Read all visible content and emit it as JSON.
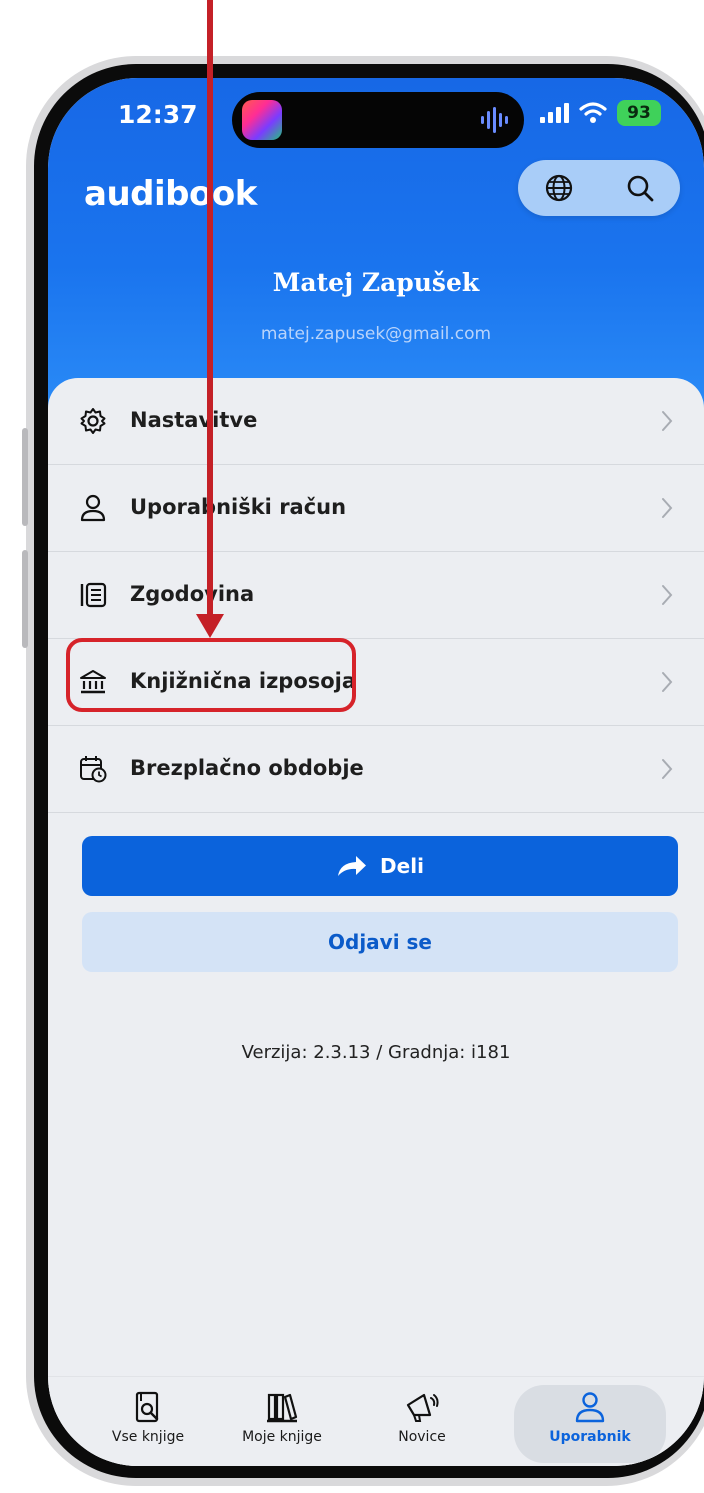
{
  "status_bar": {
    "time": "12:37",
    "battery": "93"
  },
  "header": {
    "logo": "audibook"
  },
  "profile": {
    "name": "Matej Zapušek",
    "email": "matej.zapusek@gmail.com"
  },
  "menu": {
    "items": [
      {
        "label": "Nastavitve",
        "icon": "gear-icon"
      },
      {
        "label": "Uporabniški račun",
        "icon": "user-icon"
      },
      {
        "label": "Zgodovina",
        "icon": "history-list-icon"
      },
      {
        "label": "Knjižnična izposoja",
        "icon": "library-building-icon"
      },
      {
        "label": "Brezplačno obdobje",
        "icon": "calendar-clock-icon"
      }
    ]
  },
  "actions": {
    "share_label": "Deli",
    "logout_label": "Odjavi se"
  },
  "version_text": "Verzija: 2.3.13 / Gradnja: i181",
  "tabs": [
    {
      "label": "Vse knjige",
      "icon": "book-search-icon",
      "active": false
    },
    {
      "label": "Moje knjige",
      "icon": "bookshelf-icon",
      "active": false
    },
    {
      "label": "Novice",
      "icon": "megaphone-icon",
      "active": false
    },
    {
      "label": "Uporabnik",
      "icon": "user-icon",
      "active": true
    }
  ],
  "colors": {
    "header_blue": "#1a6fea",
    "primary_button": "#0b63dc",
    "annotation_red": "#d6232a"
  },
  "annotation": {
    "highlighted_item": "Knjižnična izposoja"
  }
}
